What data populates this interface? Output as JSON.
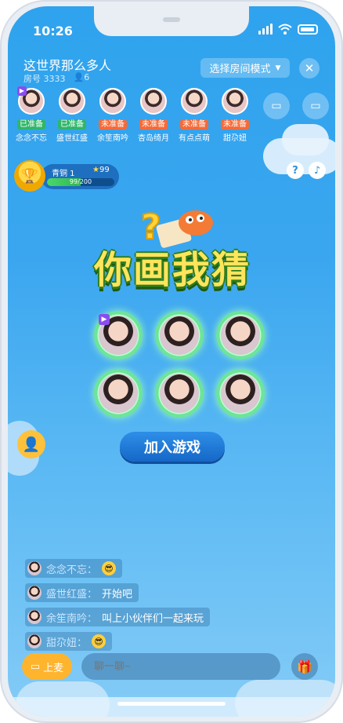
{
  "status_bar": {
    "time": "10:26"
  },
  "room": {
    "title": "这世界那么多人",
    "id_label": "房号 3333",
    "online_count": "6",
    "mode_button": "选择房间模式",
    "mode_caret": "▼",
    "close_glyph": "✕"
  },
  "seats": [
    {
      "name": "念念不忘",
      "status": "已准备",
      "ready": true,
      "vip": true
    },
    {
      "name": "盛世红盛",
      "status": "已准备",
      "ready": true,
      "vip": false
    },
    {
      "name": "余笙南吟",
      "status": "未准备",
      "ready": false,
      "vip": false
    },
    {
      "name": "杏岛绮月",
      "status": "未准备",
      "ready": false,
      "vip": false
    },
    {
      "name": "有点点萌",
      "status": "未准备",
      "ready": false,
      "vip": false
    },
    {
      "name": "甜尕妞",
      "status": "未准备",
      "ready": false,
      "vip": false
    }
  ],
  "level": {
    "name": "青铜 1",
    "stars": "99",
    "progress_text": "99/200",
    "progress_fraction": 0.495
  },
  "help_glyph": "?",
  "music_glyph": "♪",
  "game": {
    "logo_text": "你画我猜"
  },
  "join_button": "加入游戏",
  "chat": [
    {
      "name": "念念不忘：",
      "text": "",
      "emoji": "😎"
    },
    {
      "name": "盛世红盛：",
      "text": "开始吧",
      "emoji": ""
    },
    {
      "name": "余笙南吟：",
      "text": "叫上小伙伴们一起来玩",
      "emoji": ""
    },
    {
      "name": "甜尕妞：",
      "text": "",
      "emoji": "😎"
    }
  ],
  "bottom": {
    "mic_label": "上麦",
    "input_placeholder": "聊一聊~"
  },
  "colors": {
    "ready": "#2fb66a",
    "unready": "#f36b3a",
    "accent": "#ffb42e",
    "join": "#1667c7"
  }
}
